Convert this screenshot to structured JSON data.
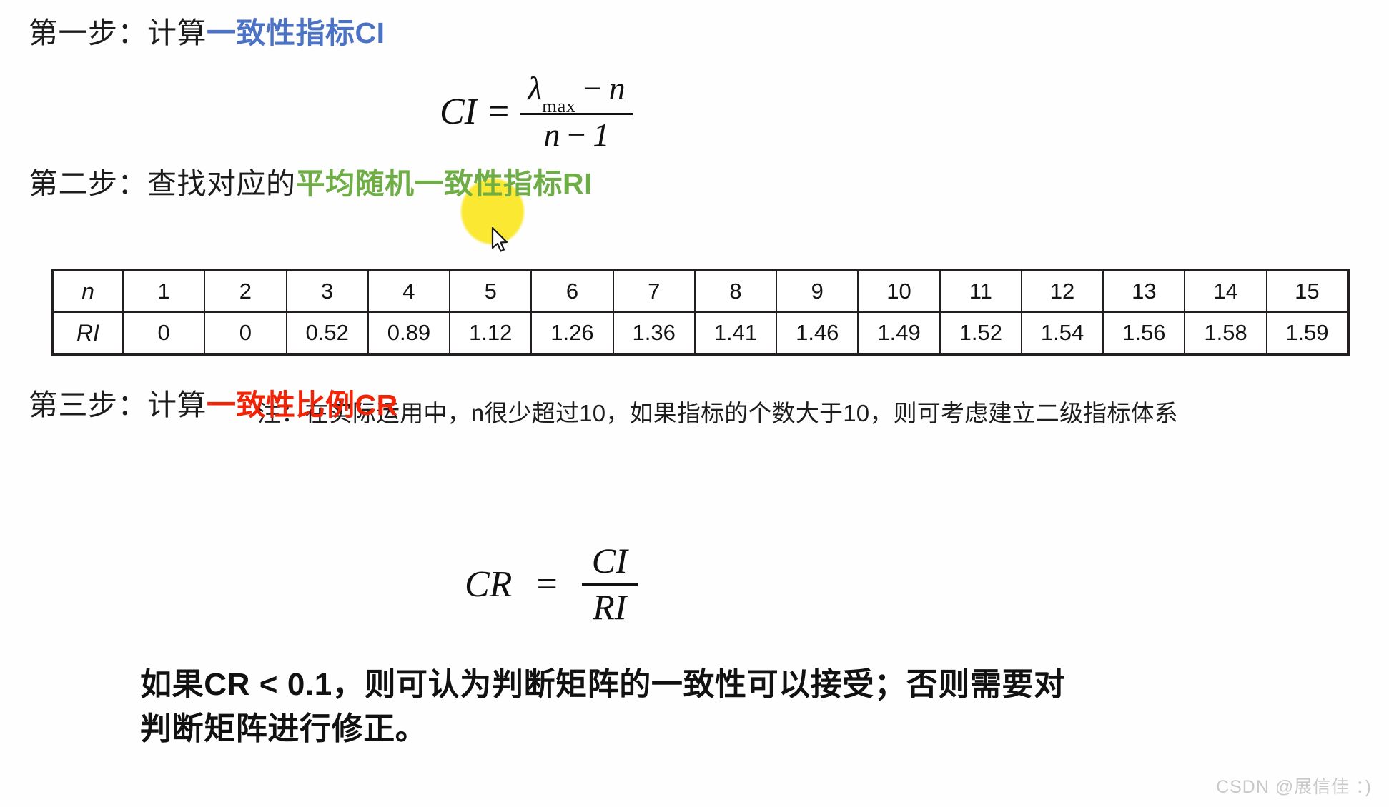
{
  "slide": {
    "background_color": "#ffffff"
  },
  "steps": [
    {
      "id": "step1",
      "lead": "第一步：计算",
      "accent": "一致性指标CI",
      "accent_color": "#4b72c4"
    },
    {
      "id": "step2",
      "lead": "第二步：查找对应的",
      "accent": "平均随机一致性指标RI",
      "accent_color": "#6fae46"
    },
    {
      "id": "step3",
      "lead": "第三步：计算",
      "accent": "一致性比例CR",
      "accent_color": "#f22306"
    }
  ],
  "formulas": {
    "ci": {
      "lhs": "CI",
      "eq": "=",
      "numerator_lambda": "λ",
      "numerator_sub": "max",
      "numerator_minus": "−",
      "numerator_n": "n",
      "denominator_n": "n",
      "denominator_minus": "−",
      "denominator_one": "1"
    },
    "cr": {
      "lhs": "CR",
      "eq": "=",
      "numerator": "CI",
      "denominator": "RI"
    }
  },
  "ri_table": {
    "row_labels": [
      "n",
      "RI"
    ],
    "n_values": [
      "1",
      "2",
      "3",
      "4",
      "5",
      "6",
      "7",
      "8",
      "9",
      "10",
      "11",
      "12",
      "13",
      "14",
      "15"
    ],
    "ri_values": [
      "0",
      "0",
      "0.52",
      "0.89",
      "1.12",
      "1.26",
      "1.36",
      "1.41",
      "1.46",
      "1.49",
      "1.52",
      "1.54",
      "1.56",
      "1.58",
      "1.59"
    ]
  },
  "note": "注：在实际运用中，n很少超过10，如果指标的个数大于10，则可考虑建立二级指标体系",
  "conclusion": {
    "line1": "如果CR < 0.1，则可认为判断矩阵的一致性可以接受；否则需要对",
    "line2": "判断矩阵进行修正。"
  },
  "annotations": {
    "highlight_color": "#fbe721",
    "cursor_icon": "mouse-pointer-icon"
  },
  "watermark": "CSDN @展信佳 ：)"
}
